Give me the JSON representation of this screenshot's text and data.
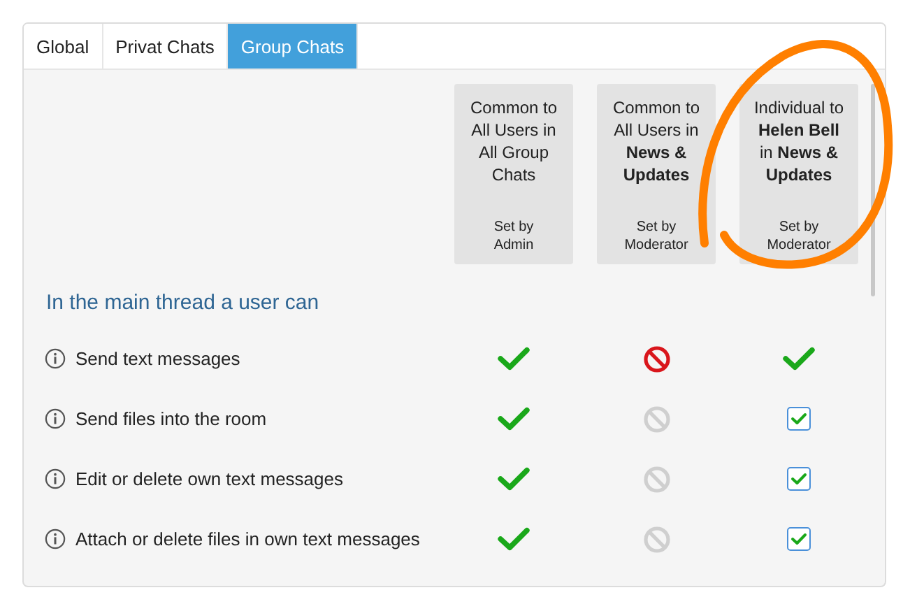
{
  "tabs": [
    {
      "label": "Global",
      "selected": false
    },
    {
      "label": "Privat Chats",
      "selected": false
    },
    {
      "label": "Group Chats",
      "selected": true
    }
  ],
  "columns": [
    {
      "title": "Common to All Users in All Group Chats",
      "footer": "Set by Admin"
    },
    {
      "title": "Common to All Users in **News & Updates**",
      "footer": "Set by Moderator"
    },
    {
      "title": "Individual to **Helen Bell** in **News & Updates**",
      "footer": "Set by Moderator"
    }
  ],
  "section_title": "In the main thread a user can",
  "rows": [
    {
      "label": "Send text messages",
      "cells": [
        {
          "kind": "allowed"
        },
        {
          "kind": "denied"
        },
        {
          "kind": "allowed"
        }
      ]
    },
    {
      "label": "Send files into the room",
      "cells": [
        {
          "kind": "allowed"
        },
        {
          "kind": "denied_inactive"
        },
        {
          "kind": "checkbox",
          "checked": true
        }
      ]
    },
    {
      "label": "Edit or delete own text messages",
      "cells": [
        {
          "kind": "allowed"
        },
        {
          "kind": "denied_inactive"
        },
        {
          "kind": "checkbox",
          "checked": true
        }
      ]
    },
    {
      "label": "Attach or delete files in own text messages",
      "cells": [
        {
          "kind": "allowed"
        },
        {
          "kind": "denied_inactive"
        },
        {
          "kind": "checkbox",
          "checked": true
        }
      ]
    }
  ]
}
